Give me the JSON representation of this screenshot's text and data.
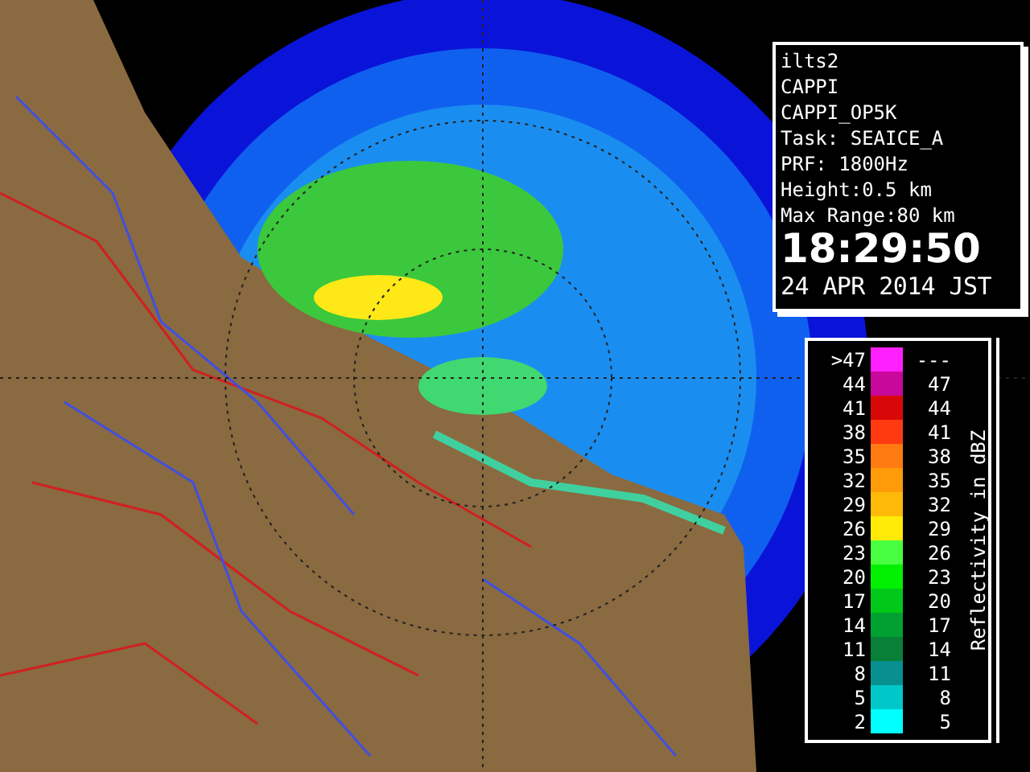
{
  "info_panel": {
    "lines": [
      "ilts2",
      "CAPPI",
      "CAPPI_OP5K",
      "Task: SEAICE_A",
      "PRF: 1800Hz",
      "Height:0.5 km",
      "Max Range:80 km"
    ],
    "time": "18:29:50",
    "date": "24 APR 2014 JST"
  },
  "legend": {
    "title": "Reflectivity in dBZ",
    "rows": [
      {
        "low": ">47",
        "high": "---",
        "color": "#ff20ff"
      },
      {
        "low": "44",
        "high": "47",
        "color": "#c8089a"
      },
      {
        "low": "41",
        "high": "44",
        "color": "#d80808"
      },
      {
        "low": "38",
        "high": "41",
        "color": "#ff3a10"
      },
      {
        "low": "35",
        "high": "38",
        "color": "#ff7a10"
      },
      {
        "low": "32",
        "high": "35",
        "color": "#ff9a08"
      },
      {
        "low": "29",
        "high": "32",
        "color": "#ffba08"
      },
      {
        "low": "26",
        "high": "29",
        "color": "#ffea08"
      },
      {
        "low": "23",
        "high": "26",
        "color": "#48ff40"
      },
      {
        "low": "20",
        "high": "23",
        "color": "#00f000"
      },
      {
        "low": "17",
        "high": "20",
        "color": "#00c818"
      },
      {
        "low": "14",
        "high": "17",
        "color": "#00a030"
      },
      {
        "low": "11",
        "high": "14",
        "color": "#088038"
      },
      {
        "low": "8",
        "high": "11",
        "color": "#089090"
      },
      {
        "low": "5",
        "high": "8",
        "color": "#00c8c8"
      },
      {
        "low": "2",
        "high": "5",
        "color": "#00ffff"
      }
    ]
  }
}
